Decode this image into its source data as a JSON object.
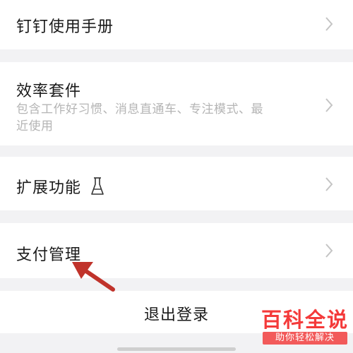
{
  "menu": {
    "manual": {
      "label": "钉钉使用手册"
    },
    "efficiency": {
      "label": "效率套件",
      "description": "包含工作好习惯、消息直通车、专注模式、最近使用"
    },
    "extensions": {
      "label": "扩展功能",
      "icon": "flask-icon"
    },
    "payment": {
      "label": "支付管理"
    }
  },
  "logout": {
    "label": "退出登录"
  },
  "watermark": {
    "title": "百科全说",
    "subtitle": "助你轻松解决"
  },
  "colors": {
    "background": "#f2f2f4",
    "row": "#ffffff",
    "arrow": "#c0332b",
    "watermark": "#f43a3a"
  }
}
